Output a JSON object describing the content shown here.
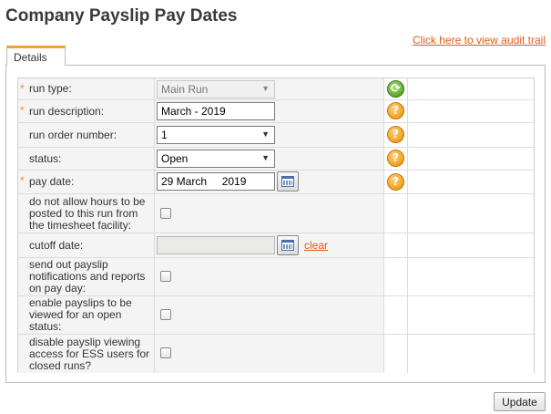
{
  "page": {
    "title": "Company Payslip Pay Dates",
    "audit_link": "Click here to view audit trail"
  },
  "tabs": [
    {
      "label": "Details"
    }
  ],
  "form": {
    "required_marker": "*",
    "run_type": {
      "label": "run type:",
      "value": "Main Run",
      "required": true
    },
    "run_description": {
      "label": "run description:",
      "value": "March - 2019",
      "required": true
    },
    "run_order_number": {
      "label": "run order number:",
      "value": "1",
      "required": false
    },
    "status": {
      "label": "status:",
      "value": "Open",
      "required": false
    },
    "pay_date": {
      "label": "pay date:",
      "value": "29 March     2019",
      "required": true
    },
    "no_timesheet_hours": {
      "label": "do not allow hours to be posted to this run from the timesheet facility:",
      "checked": false
    },
    "cutoff_date": {
      "label": "cutoff date:",
      "value": "",
      "clear_label": "clear"
    },
    "send_notifications": {
      "label": "send out payslip notifications and reports on pay day:",
      "checked": false
    },
    "enable_open_viewing": {
      "label": "enable payslips to be viewed for an open status:",
      "checked": false
    },
    "disable_ess_closed": {
      "label": "disable payslip viewing access for ESS users for closed runs?",
      "checked": false
    }
  },
  "icons": {
    "help": "?",
    "refresh": "⟳",
    "select_arrow": "▼"
  },
  "actions": {
    "update_label": "Update"
  },
  "colors": {
    "accent_orange": "#f0a034",
    "link_orange": "#e05a1c",
    "help_icon": "#f0a020",
    "refresh_icon": "#5aa830"
  }
}
